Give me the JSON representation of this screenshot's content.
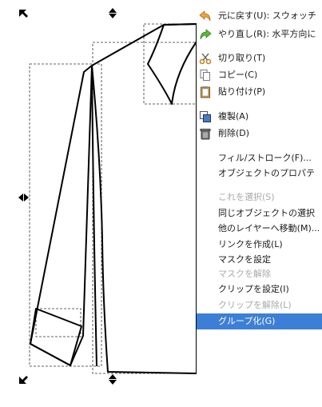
{
  "context_menu": {
    "items": [
      {
        "label": "元に戻す(U): スウォッチ",
        "icon": "undo-icon",
        "enabled": true
      },
      {
        "label": "やり直し(R): 水平方向に",
        "icon": "redo-icon",
        "enabled": true
      },
      {
        "label": "切り取り(T)",
        "icon": "scissors-icon",
        "enabled": true
      },
      {
        "label": "コピー(C)",
        "icon": "copy-icon",
        "enabled": true
      },
      {
        "label": "貼り付け(P)",
        "icon": "paste-icon",
        "enabled": true
      },
      {
        "label": "複製(A)",
        "icon": "duplicate-icon",
        "enabled": true
      },
      {
        "label": "削除(D)",
        "icon": "trash-icon",
        "enabled": true
      },
      {
        "label": "フィル/ストローク(F)...",
        "enabled": true
      },
      {
        "label": "オブジェクトのプロパテ",
        "enabled": true
      },
      {
        "label": "これを選択(S)",
        "enabled": false
      },
      {
        "label": "同じオブジェクトの選択",
        "enabled": true
      },
      {
        "label": "他のレイヤーへ移動(M)...",
        "enabled": true
      },
      {
        "label": "リンクを作成(L)",
        "enabled": true
      },
      {
        "label": "マスクを設定",
        "enabled": true
      },
      {
        "label": "マスクを解除",
        "enabled": false
      },
      {
        "label": "クリップを設定(I)",
        "enabled": true
      },
      {
        "label": "クリップを解除(L)",
        "enabled": false
      },
      {
        "label": "グループ化(G)",
        "enabled": true,
        "highlighted": true
      }
    ]
  },
  "colors": {
    "highlight": "#3d7fd6",
    "disabled_text": "#a9a9a9",
    "text": "#1a1a1a"
  }
}
